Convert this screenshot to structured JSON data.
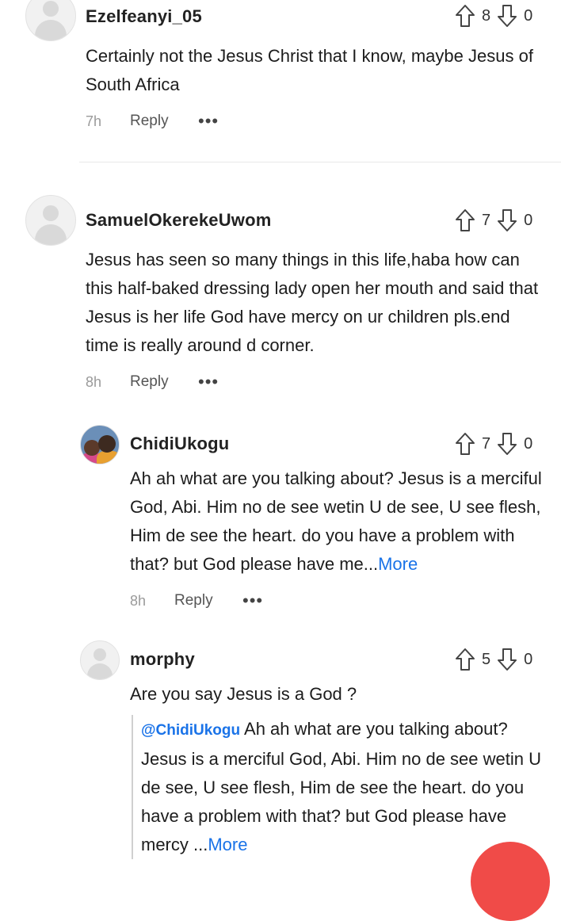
{
  "comments": [
    {
      "author": "Ezelfeanyi_05",
      "upvotes": "8",
      "downvotes": "0",
      "text": "Certainly not the Jesus Christ that I know, maybe Jesus of South Africa",
      "time": "7h",
      "reply_label": "Reply",
      "more_options": "•••"
    },
    {
      "author": "SamuelOkerekeUwom",
      "upvotes": "7",
      "downvotes": "0",
      "text": "Jesus has seen so many things in this life,haba how can this half-baked dressing lady open her mouth  and said that Jesus is her life God have mercy on ur children pls.end time is really around d corner.",
      "time": "8h",
      "reply_label": "Reply",
      "more_options": "•••"
    }
  ],
  "replies": [
    {
      "author": "ChidiUkogu",
      "upvotes": "7",
      "downvotes": "0",
      "text": "Ah ah what are you talking about? Jesus is a merciful God, Abi. Him no de see wetin U de see, U see flesh, Him de see the heart. do you have a problem with that? but God please have me...",
      "more_link": "More",
      "time": "8h",
      "reply_label": "Reply",
      "more_options": "•••"
    },
    {
      "author": "morphy",
      "upvotes": "5",
      "downvotes": "0",
      "text": "Are you say Jesus is a God ?",
      "quote": {
        "mention": "@ChidiUkogu",
        "text": " Ah ah what are you talking about? Jesus is a merciful God, Abi. Him no de see wetin U de see, U see flesh, Him de see the heart. do you have a problem with that? but God please have mercy ...",
        "more_link": "More"
      }
    }
  ],
  "colors": {
    "link": "#1a73e8",
    "fab": "#f04b48"
  },
  "icons": {
    "upvote": "arrow-up-outline-icon",
    "downvote": "arrow-down-outline-icon",
    "avatar_placeholder": "user-placeholder-icon"
  }
}
